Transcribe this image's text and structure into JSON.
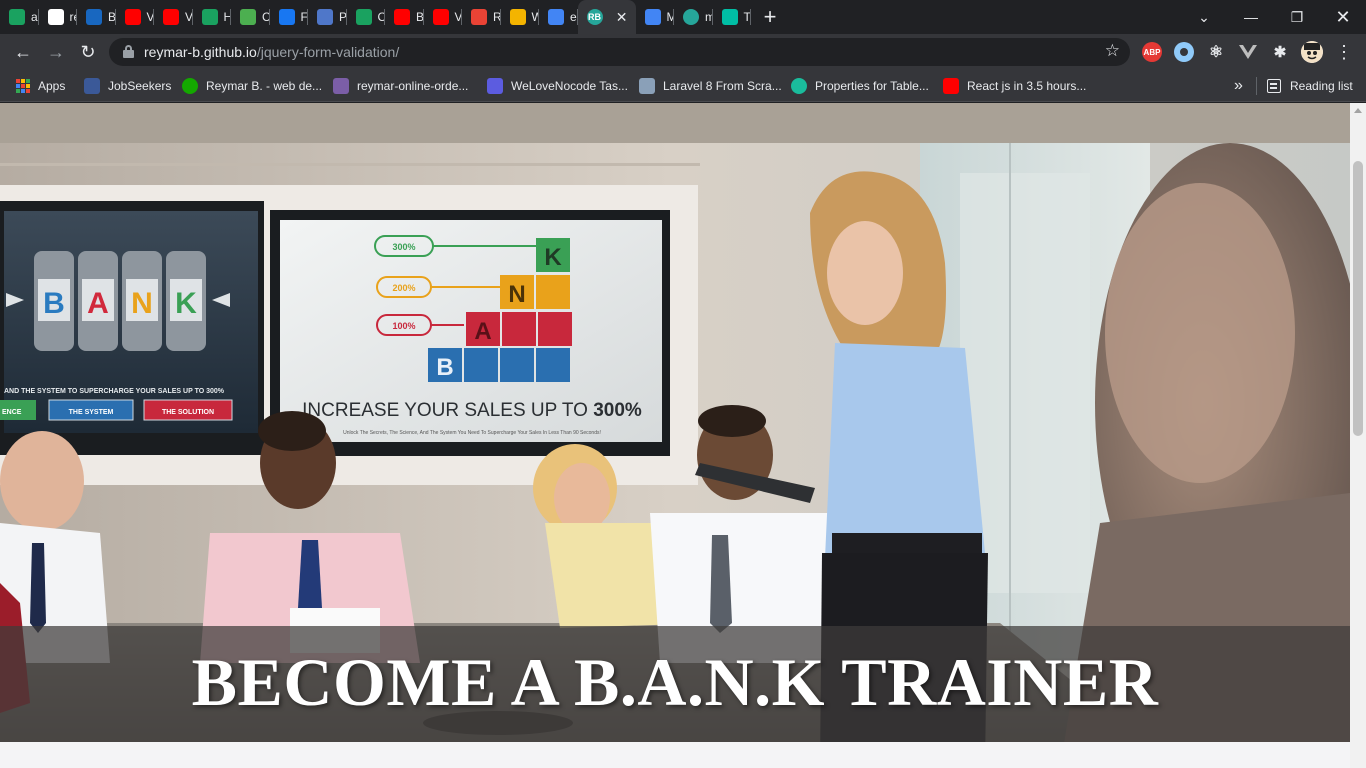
{
  "browser": {
    "tabs": [
      {
        "title": "adr",
        "icon": "vuetify-icon",
        "color": "#1aa260"
      },
      {
        "title": "rey",
        "icon": "github-icon",
        "color": "#ffffff"
      },
      {
        "title": "But",
        "icon": "vuetify-icon",
        "color": "#1867c0"
      },
      {
        "title": "Vu",
        "icon": "youtube-icon",
        "color": "#ff0000"
      },
      {
        "title": "Vu",
        "icon": "youtube-icon",
        "color": "#ff0000"
      },
      {
        "title": "HT",
        "icon": "vuetify-icon",
        "color": "#1aa260"
      },
      {
        "title": "Co",
        "icon": "mdn-icon",
        "color": "#4caf50"
      },
      {
        "title": "Fac",
        "icon": "facebook-icon",
        "color": "#1877f2"
      },
      {
        "title": "Pro",
        "icon": "globe-icon",
        "color": "#4f77c9"
      },
      {
        "title": "Co",
        "icon": "vuetify-icon",
        "color": "#1aa260"
      },
      {
        "title": "Bef",
        "icon": "youtube-icon",
        "color": "#ff0000"
      },
      {
        "title": "Vu",
        "icon": "youtube-icon",
        "color": "#ff0000"
      },
      {
        "title": "Rec",
        "icon": "gmail-icon",
        "color": "#ea4335"
      },
      {
        "title": "Wr",
        "icon": "document-icon",
        "color": "#f4b400"
      },
      {
        "title": "enc",
        "icon": "google-icon",
        "color": "#4285f4"
      },
      {
        "title": "RB",
        "icon": "rb-icon",
        "color": "#26a69a",
        "active": true
      },
      {
        "title": "My",
        "icon": "docs-icon",
        "color": "#4285f4"
      },
      {
        "title": "my",
        "icon": "rb-icon",
        "color": "#26a69a"
      },
      {
        "title": "Tea",
        "icon": "diamond-icon",
        "color": "#00bfa5"
      }
    ],
    "active_tab_favicon": "RB",
    "url_host": "reymar-b.github.io",
    "url_path": "/jquery-form-validation/",
    "extension_abp": "ABP"
  },
  "bookmarks": {
    "apps": "Apps",
    "items": [
      {
        "label": "JobSeekers",
        "icon": "jobseekers-icon",
        "color": "#3b5998"
      },
      {
        "label": "Reymar B. - web de...",
        "icon": "upwork-icon",
        "color": "#14a800"
      },
      {
        "label": "reymar-online-orde...",
        "icon": "heroku-icon",
        "color": "#7b5ea7"
      },
      {
        "label": "WeLoveNocode Tas...",
        "icon": "list-icon",
        "color": "#5c5ce0"
      },
      {
        "label": "Laravel 8 From Scra...",
        "icon": "laracasts-icon",
        "color": "#8aa0b8"
      },
      {
        "label": "Properties for Table...",
        "icon": "tailwind-icon",
        "color": "#1abc9c"
      },
      {
        "label": "React js in 3.5 hours...",
        "icon": "youtube-icon",
        "color": "#ff0000"
      }
    ],
    "more": "»",
    "reading_list": "Reading list"
  },
  "hero": {
    "title": "BECOME A B.A.N.K TRAINER",
    "screen_left": {
      "reel_letters": [
        "B",
        "A",
        "N",
        "K"
      ],
      "caption": "AND THE SYSTEM TO SUPERCHARGE YOUR SALES UP TO 300%",
      "buttons": [
        "ENCE",
        "THE SYSTEM",
        "THE SOLUTION"
      ]
    },
    "screen_right": {
      "percent_labels": [
        "300%",
        "200%",
        "100%"
      ],
      "block_letters": [
        "K",
        "N",
        "A",
        "B"
      ],
      "headline": "INCREASE YOUR SALES UP TO",
      "headline_bold": "300%",
      "subline": "Unlock The Secrets, The Science, And The System You Need To Supercharge Your Sales In Less Than 90 Seconds!"
    }
  }
}
